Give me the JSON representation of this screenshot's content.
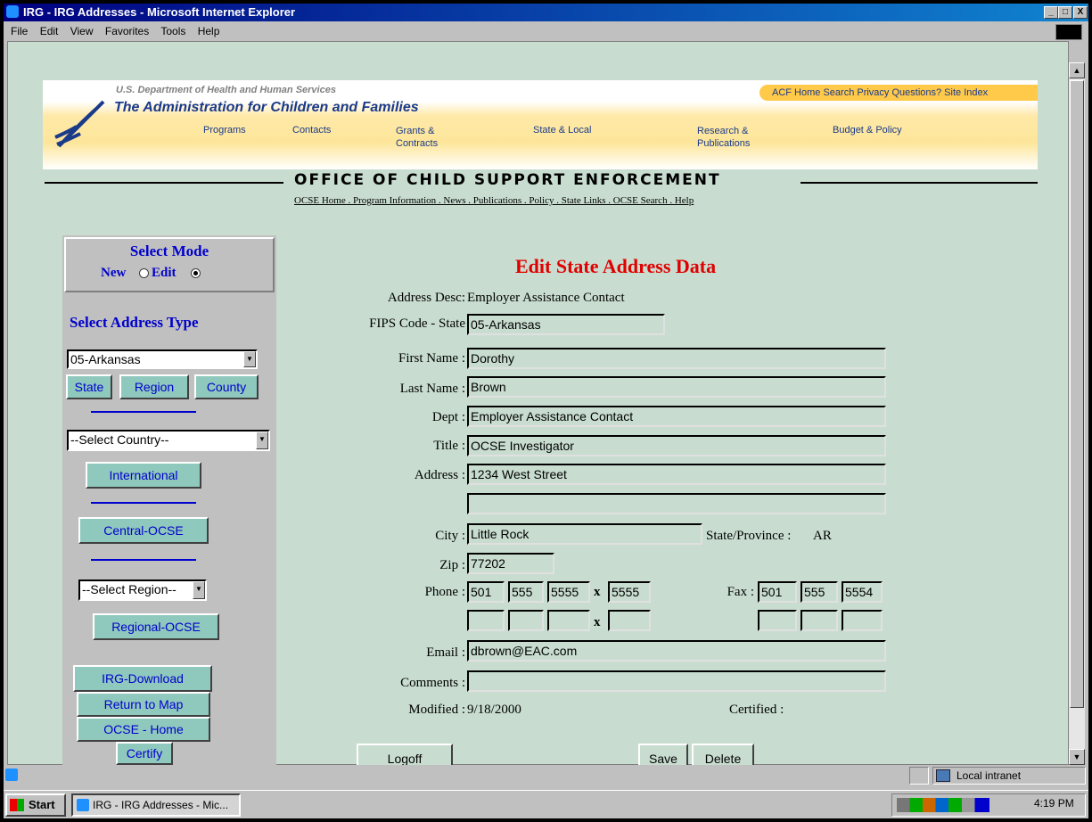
{
  "window": {
    "title": "IRG - IRG Addresses - Microsoft Internet Explorer",
    "min": "_",
    "max": "□",
    "close": "X"
  },
  "menu": [
    "File",
    "Edit",
    "View",
    "Favorites",
    "Tools",
    "Help"
  ],
  "banner": {
    "dept": "U.S. Department of Health and Human Services",
    "agency": "The Administration for Children and Families",
    "top_links": "ACF Home  Search  Privacy  Questions?  Site Index",
    "nav": [
      "Programs",
      "Contacts",
      "Grants &\nContracts",
      "State & Local",
      "Research &\nPublications",
      "Budget & Policy"
    ],
    "office": "OFFICE OF CHILD SUPPORT ENFORCEMENT",
    "sub_links": "OCSE Home . Program Information . News . Publications . Policy . State Links . OCSE Search . Help"
  },
  "sidebar": {
    "mode_title": "Select Mode",
    "mode_new": "New",
    "mode_edit": "Edit",
    "address_type_title": "Select Address Type",
    "state_select": "05-Arkansas",
    "btn_state": "State",
    "btn_region": "Region",
    "btn_county": "County",
    "country_select": "--Select Country--",
    "btn_international": "International",
    "btn_central": "Central-OCSE",
    "region_select": "--Select Region--",
    "btn_regional": "Regional-OCSE",
    "btn_download": "IRG-Download",
    "btn_map": "Return to Map",
    "btn_home": "OCSE - Home",
    "btn_certify": "Certify"
  },
  "form": {
    "heading": "Edit State Address Data",
    "addr_desc_label": "Address Desc:",
    "addr_desc": "Employer Assistance Contact",
    "fips_label": "FIPS Code - State",
    "fips": "05-Arkansas",
    "first_label": "First Name :",
    "first": "Dorothy",
    "last_label": "Last Name :",
    "last": "Brown",
    "dept_label": "Dept :",
    "dept": "Employer Assistance Contact",
    "title_label": "Title :",
    "title": "OCSE Investigator",
    "address_label": "Address :",
    "address1": "1234 West Street",
    "address2": "",
    "city_label": "City :",
    "city": "Little Rock",
    "state_prov_label": "State/Province :",
    "state_prov": "AR",
    "zip_label": "Zip :",
    "zip": "77202",
    "phone_label": "Phone :",
    "phone": [
      "501",
      "555",
      "5555",
      "5555"
    ],
    "x": "x",
    "fax_label": "Fax :",
    "fax": [
      "501",
      "555",
      "5554"
    ],
    "email_label": "Email :",
    "email": "dbrown@EAC.com",
    "comments_label": "Comments :",
    "comments": "",
    "modified_label": "Modified :",
    "modified": "9/18/2000",
    "certified_label": "Certified :",
    "btn_logoff": "Logoff",
    "btn_save": "Save",
    "btn_delete": "Delete"
  },
  "status": {
    "zone": "Local intranet"
  },
  "taskbar": {
    "start": "Start",
    "task": "IRG - IRG Addresses - Mic...",
    "time": "4:19 PM"
  }
}
